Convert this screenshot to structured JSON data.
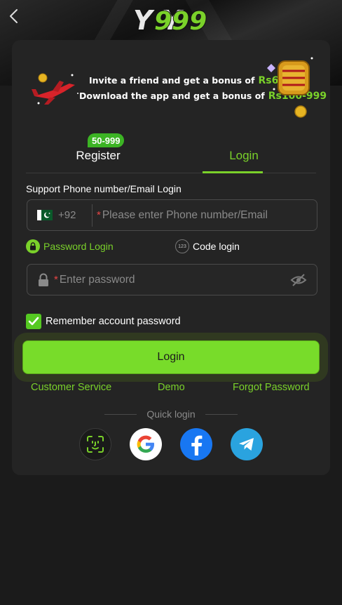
{
  "header": {
    "logo_text": "Y999"
  },
  "banner": {
    "line1_text": "Invite a friend and get a bonus of",
    "line1_amount": "Rs600",
    "line2_text": "Download the app and get a bonus of",
    "line2_amount": "Rs100-999"
  },
  "tabs": {
    "register_label": "Register",
    "register_badge": "50-999",
    "login_label": "Login"
  },
  "form": {
    "section_label": "Support Phone number/Email Login",
    "country_code": "+92",
    "phone_required_mark": "*",
    "phone_placeholder": "Please enter Phone number/Email",
    "mode_password_label": "Password Login",
    "mode_code_label": "Code login",
    "code_icon_text": "123",
    "password_required_mark": "*",
    "password_placeholder": "Enter password",
    "remember_label": "Remember account password",
    "remember_checked": true,
    "login_button": "Login"
  },
  "links": {
    "customer_service": "Customer Service",
    "demo": "Demo",
    "forgot_password": "Forgot Password"
  },
  "quick_login": {
    "label": "Quick login",
    "providers": [
      "face-id-icon",
      "google-icon",
      "facebook-icon",
      "telegram-icon"
    ]
  },
  "colors": {
    "accent": "#7ad12a",
    "button": "#78dc2a",
    "required": "#e64545",
    "card": "#242424",
    "background": "#1b1b1b"
  }
}
